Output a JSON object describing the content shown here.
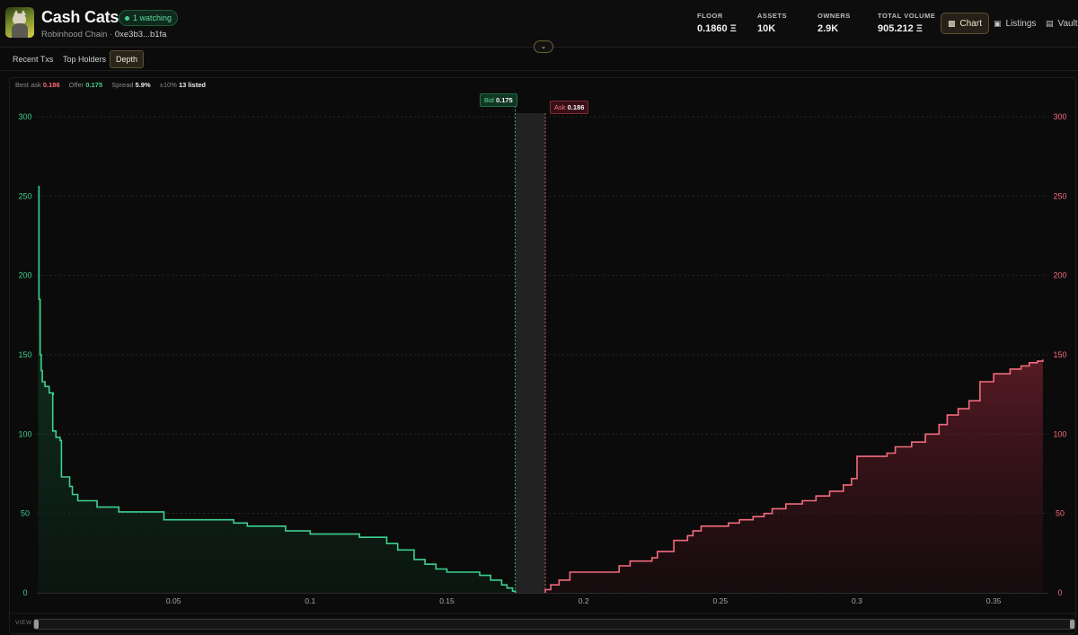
{
  "header": {
    "title": "Cash Cats",
    "watching": "1 watching",
    "chain": "Robinhood Chain · ",
    "address": "0xe3b3...b1fa",
    "stats": [
      {
        "label": "FLOOR",
        "value": "0.1860 Ξ"
      },
      {
        "label": "ASSETS",
        "value": "10K"
      },
      {
        "label": "OWNERS",
        "value": "2.9K"
      },
      {
        "label": "TOTAL VOLUME",
        "value": "905.212 Ξ"
      }
    ],
    "nav": [
      {
        "label": "Chart",
        "icon": "bar-chart-icon",
        "active": true
      },
      {
        "label": "Listings",
        "icon": "calendar-icon",
        "active": false
      },
      {
        "label": "Vault",
        "icon": "cart-icon",
        "active": false
      }
    ]
  },
  "tabs": [
    {
      "label": "Recent Txs",
      "active": false
    },
    {
      "label": "Top Holders",
      "active": false
    },
    {
      "label": "Depth",
      "active": true
    }
  ],
  "infobar": {
    "best_ask_label": "Best ask",
    "best_ask": "0.186",
    "offer_label": "Offer",
    "offer": "0.175",
    "spread_label": "Spread",
    "spread": "5.9%",
    "range_label": "±10%",
    "listed": "13 listed"
  },
  "markers": {
    "bid_label": "Bid",
    "bid_value": "0.175",
    "ask_label": "Ask",
    "ask_value": "0.186"
  },
  "viewbar": {
    "label": "VIEW"
  },
  "colors": {
    "bid": "#3ecf8e",
    "ask": "#f26b7c",
    "accent": "#d8c88e",
    "background": "#0b0b0b"
  },
  "chart_data": {
    "type": "area",
    "xlim": [
      0,
      0.37
    ],
    "ylim": [
      0,
      300
    ],
    "x_ticks": [
      0.05,
      0.1,
      0.15,
      0.2,
      0.25,
      0.3,
      0.35
    ],
    "x_tick_labels": [
      "0.05",
      "0.1",
      "0.15",
      "0.2",
      "0.25",
      "0.3",
      "0.35"
    ],
    "y_ticks": [
      0,
      50,
      100,
      150,
      200,
      250,
      300
    ],
    "y_tick_labels": [
      "0",
      "50",
      "100",
      "150",
      "200",
      "250",
      "300"
    ],
    "grid": true,
    "best_bid": 0.175,
    "best_ask": 0.186,
    "series": [
      {
        "name": "Bid",
        "values": [
          [
            0.0005,
            256
          ],
          [
            0.0008,
            185
          ],
          [
            0.0012,
            150
          ],
          [
            0.0016,
            140
          ],
          [
            0.002,
            133
          ],
          [
            0.003,
            130
          ],
          [
            0.0045,
            126
          ],
          [
            0.006,
            125
          ],
          [
            0.0058,
            102
          ],
          [
            0.007,
            98
          ],
          [
            0.0085,
            96
          ],
          [
            0.009,
            73
          ],
          [
            0.012,
            67
          ],
          [
            0.013,
            62
          ],
          [
            0.015,
            58
          ],
          [
            0.022,
            54
          ],
          [
            0.03,
            51
          ],
          [
            0.0465,
            46
          ],
          [
            0.072,
            44
          ],
          [
            0.077,
            42
          ],
          [
            0.091,
            39
          ],
          [
            0.1,
            37
          ],
          [
            0.118,
            35
          ],
          [
            0.128,
            31
          ],
          [
            0.132,
            27
          ],
          [
            0.138,
            21
          ],
          [
            0.142,
            18
          ],
          [
            0.146,
            15
          ],
          [
            0.15,
            13
          ],
          [
            0.162,
            11
          ],
          [
            0.166,
            8
          ],
          [
            0.17,
            5
          ],
          [
            0.172,
            3
          ],
          [
            0.174,
            1
          ],
          [
            0.175,
            0
          ]
        ]
      },
      {
        "name": "Ask",
        "values": [
          [
            0.186,
            2
          ],
          [
            0.188,
            5
          ],
          [
            0.191,
            8
          ],
          [
            0.195,
            13
          ],
          [
            0.213,
            17
          ],
          [
            0.217,
            20
          ],
          [
            0.225,
            22
          ],
          [
            0.227,
            26
          ],
          [
            0.233,
            33
          ],
          [
            0.238,
            36
          ],
          [
            0.24,
            39
          ],
          [
            0.243,
            42
          ],
          [
            0.253,
            44
          ],
          [
            0.257,
            46
          ],
          [
            0.262,
            48
          ],
          [
            0.266,
            50
          ],
          [
            0.269,
            53
          ],
          [
            0.274,
            56
          ],
          [
            0.28,
            58
          ],
          [
            0.285,
            61
          ],
          [
            0.29,
            64
          ],
          [
            0.295,
            68
          ],
          [
            0.298,
            72
          ],
          [
            0.3,
            86
          ],
          [
            0.311,
            88
          ],
          [
            0.314,
            92
          ],
          [
            0.32,
            95
          ],
          [
            0.325,
            100
          ],
          [
            0.33,
            106
          ],
          [
            0.333,
            112
          ],
          [
            0.337,
            116
          ],
          [
            0.341,
            121
          ],
          [
            0.345,
            133
          ],
          [
            0.35,
            138
          ],
          [
            0.356,
            141
          ],
          [
            0.36,
            143
          ],
          [
            0.363,
            145
          ],
          [
            0.366,
            146
          ],
          [
            0.368,
            147
          ]
        ]
      }
    ]
  }
}
